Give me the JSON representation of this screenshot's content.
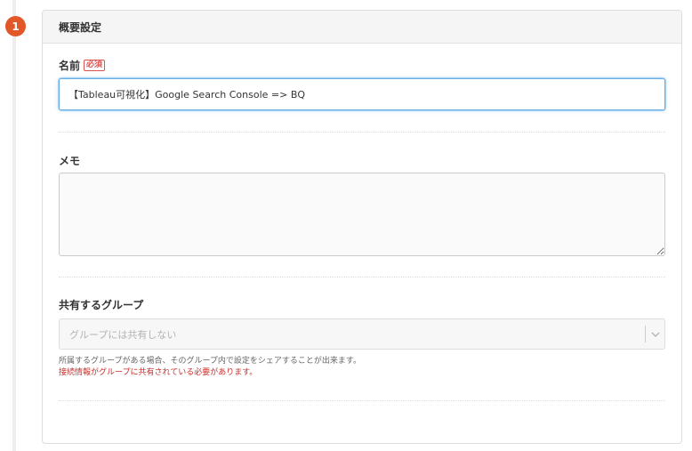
{
  "step": {
    "number": "1"
  },
  "section": {
    "title": "概要設定"
  },
  "name_field": {
    "label": "名前",
    "required_label": "必須",
    "value": "【Tableau可視化】Google Search Console => BQ"
  },
  "memo_field": {
    "label": "メモ",
    "value": ""
  },
  "group_field": {
    "label": "共有するグループ",
    "selected": "グループには共有しない",
    "help": "所属するグループがある場合、そのグループ内で設定をシェアすることが出来ます。",
    "warning": "接続情報がグループに共有されている必要があります。"
  },
  "colors": {
    "step_badge": "#e2572a",
    "required": "#d9534f",
    "focus_border": "#66afe9",
    "warning_text": "#c9302c"
  }
}
